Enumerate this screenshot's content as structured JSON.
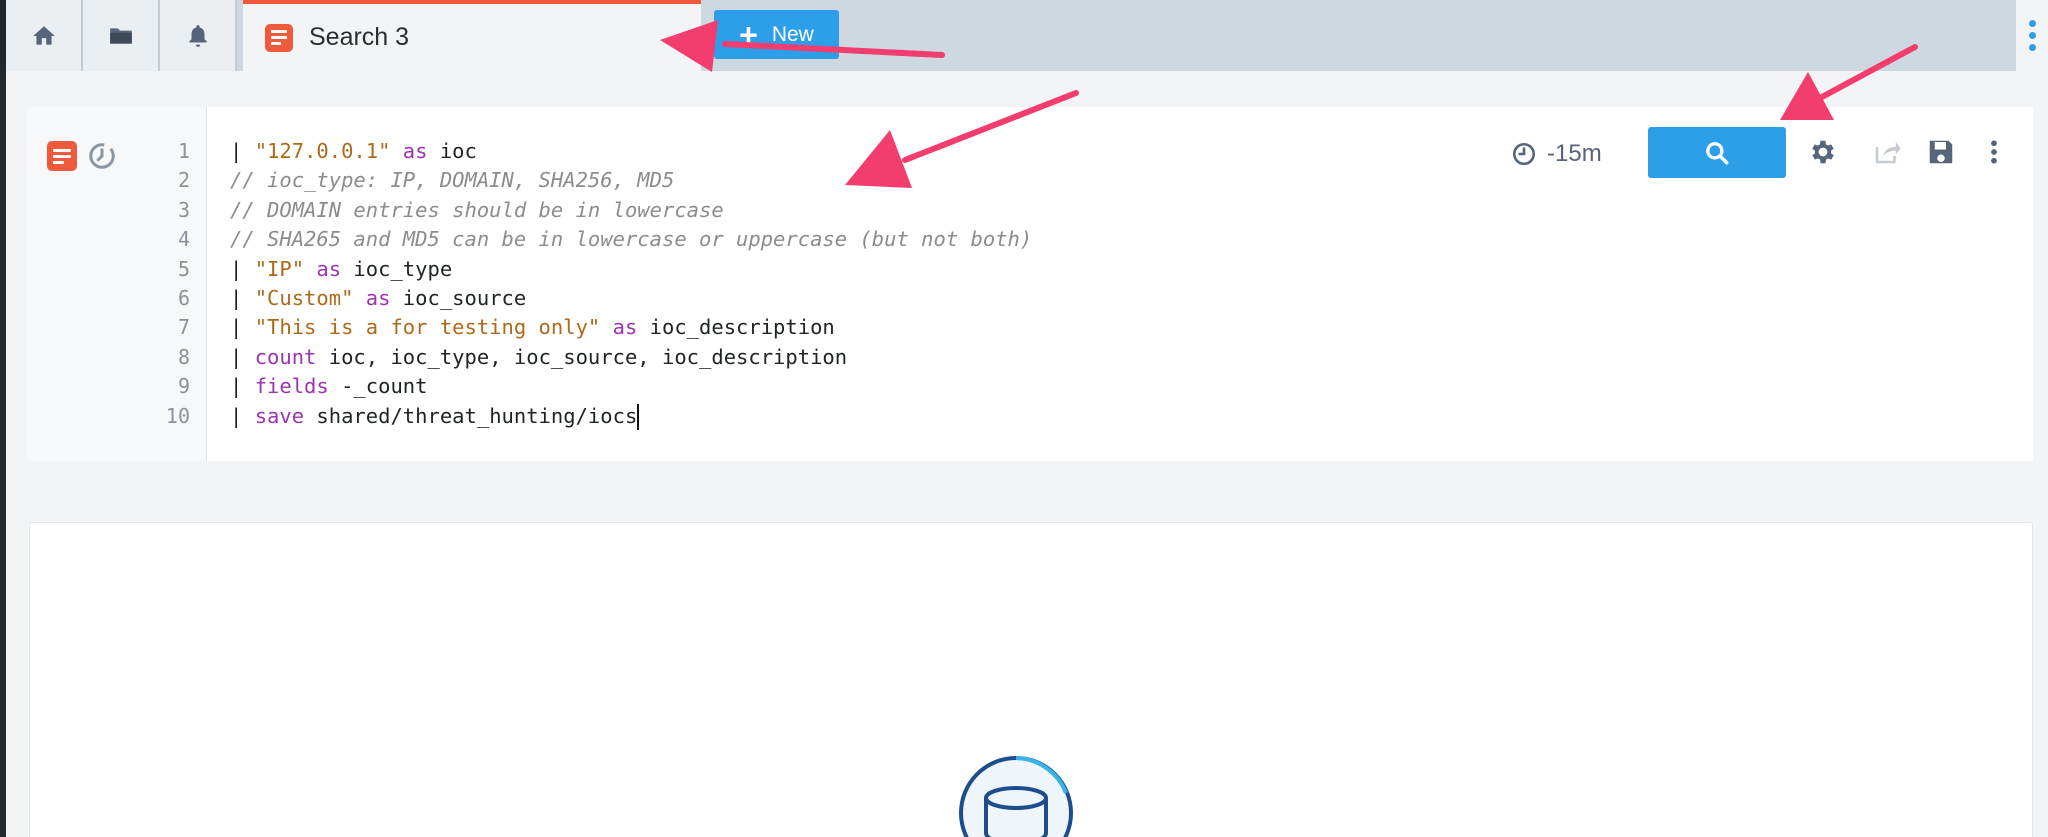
{
  "tabs": {
    "icons": [
      "home-icon",
      "folder-icon",
      "bell-icon"
    ],
    "active": {
      "label": "Search 3",
      "icon": "search-doc-icon"
    },
    "new_button": {
      "label": "New",
      "icon": "plus-icon"
    }
  },
  "editor": {
    "time_range": "-15m",
    "line_numbers": [
      "1",
      "2",
      "3",
      "4",
      "5",
      "6",
      "7",
      "8",
      "9",
      "10"
    ],
    "lines": [
      [
        {
          "t": "| ",
          "c": "plain"
        },
        {
          "t": "\"127.0.0.1\"",
          "c": "str"
        },
        {
          "t": " as",
          "c": "kw"
        },
        {
          "t": " ioc",
          "c": "plain"
        }
      ],
      [
        {
          "t": "// ioc_type: IP, DOMAIN, SHA256, MD5",
          "c": "cmt"
        }
      ],
      [
        {
          "t": "// DOMAIN entries should be in lowercase",
          "c": "cmt"
        }
      ],
      [
        {
          "t": "// SHA265 and MD5 can be in lowercase or uppercase (but not both)",
          "c": "cmt"
        }
      ],
      [
        {
          "t": "| ",
          "c": "plain"
        },
        {
          "t": "\"IP\"",
          "c": "str"
        },
        {
          "t": " as",
          "c": "kw"
        },
        {
          "t": " ioc_type",
          "c": "plain"
        }
      ],
      [
        {
          "t": "| ",
          "c": "plain"
        },
        {
          "t": "\"Custom\"",
          "c": "str"
        },
        {
          "t": " as",
          "c": "kw"
        },
        {
          "t": " ioc_source",
          "c": "plain"
        }
      ],
      [
        {
          "t": "| ",
          "c": "plain"
        },
        {
          "t": "\"This is a for testing only\"",
          "c": "str"
        },
        {
          "t": " as",
          "c": "kw"
        },
        {
          "t": " ioc_description",
          "c": "plain"
        }
      ],
      [
        {
          "t": "| ",
          "c": "plain"
        },
        {
          "t": "count",
          "c": "kw"
        },
        {
          "t": " ioc, ioc_type, ioc_source, ioc_description",
          "c": "plain"
        }
      ],
      [
        {
          "t": "| ",
          "c": "plain"
        },
        {
          "t": "fields",
          "c": "kw"
        },
        {
          "t": " -_count",
          "c": "plain"
        }
      ],
      [
        {
          "t": "| ",
          "c": "plain"
        },
        {
          "t": "save",
          "c": "kw"
        },
        {
          "t": " shared/threat_hunting/iocs",
          "c": "plain"
        }
      ]
    ],
    "toolbar_icons": [
      "clock-icon",
      "search-icon",
      "gear-icon",
      "share-icon",
      "save-icon",
      "more-vertical-icon"
    ]
  },
  "results": {
    "empty_icon": "database-icon"
  },
  "colors": {
    "accent": "#2d9ee8",
    "brand": "#ef5a3a",
    "annotation_arrow": "#f23d6e",
    "string": "#ad6a1a",
    "keyword": "#9b35ad",
    "comment": "#8c8c8c"
  }
}
